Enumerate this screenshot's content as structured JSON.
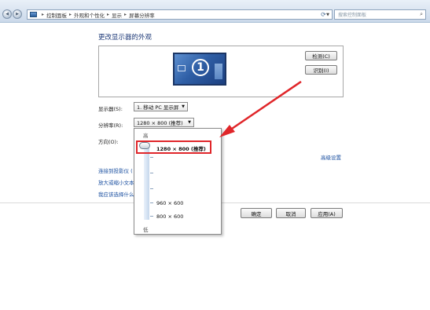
{
  "nav": {
    "back_glyph": "◀",
    "forward_glyph": "▶",
    "dropdown_glyph": "▼"
  },
  "address_bar": {
    "crumbs": [
      "控制面板",
      "外观和个性化",
      "显示",
      "屏幕分辨率"
    ],
    "separator": "▸"
  },
  "search": {
    "placeholder": "搜索控制面板",
    "icon": "search-icon"
  },
  "page": {
    "title": "更改显示器的外观"
  },
  "preview": {
    "monitor_number": "1",
    "detect_button": "检测(C)",
    "identify_button": "识别(I)"
  },
  "settings": {
    "display_label": "显示器(S):",
    "display_value": "1. 移动 PC 显示屏",
    "resolution_label": "分辨率(R):",
    "resolution_value": "1280 × 800 (推荐)",
    "orientation_label": "方向(O):",
    "advanced_link": "高级设置"
  },
  "links": {
    "projector": "连接到投影仪 (",
    "text_size": "放大或缩小文本",
    "which_settings": "我应该选择什么"
  },
  "resolution_slider": {
    "high_label": "高",
    "low_label": "低",
    "options": [
      "1280 × 800 (推荐)",
      "960 × 600",
      "800 × 600"
    ],
    "selected": "1280 × 800 (推荐)"
  },
  "footer": {
    "ok_button": "确定",
    "cancel_button": "取消",
    "apply_button": "应用(A)"
  },
  "colors": {
    "highlight": "#e0262a",
    "link": "#1a4fa0",
    "title": "#1e3a78"
  }
}
